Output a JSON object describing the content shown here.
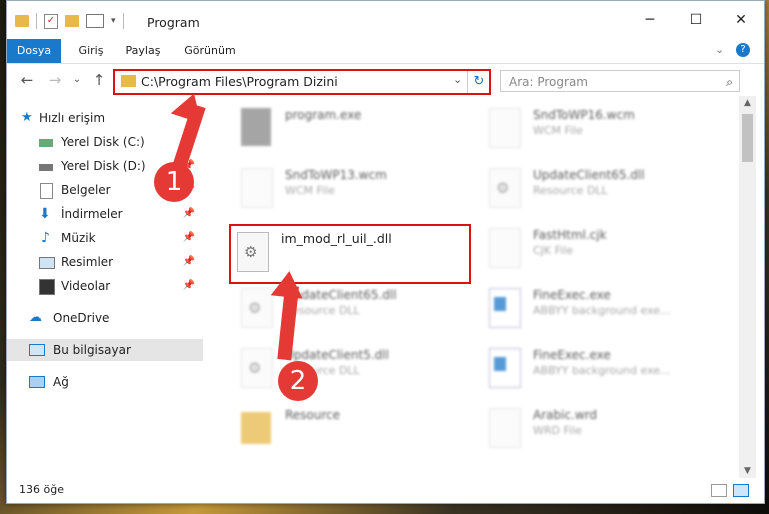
{
  "window": {
    "title": "Program",
    "minimize": "─",
    "maximize": "☐",
    "close": "✕"
  },
  "ribbon": {
    "tabs": [
      "Dosya",
      "Giriş",
      "Paylaş",
      "Görünüm"
    ],
    "collapse": "⌄",
    "help": "?"
  },
  "nav": {
    "back": "←",
    "forward": "→",
    "recent": "⌄",
    "up": "↑",
    "address": "C:\\Program Files\\Program Dizini",
    "dropdown": "⌄",
    "refresh": "↻",
    "search_placeholder": "Ara: Program",
    "search_icon": "⌕"
  },
  "sidebar": {
    "items": [
      {
        "label": "Hızlı erişim",
        "icon": "star-icon"
      },
      {
        "label": "Yerel Disk (C:)",
        "icon": "drive-icon",
        "pin": "📌"
      },
      {
        "label": "Yerel Disk (D:)",
        "icon": "drive-icon",
        "pin": "📌"
      },
      {
        "label": "Belgeler",
        "icon": "documents-icon",
        "pin": "📌"
      },
      {
        "label": "İndirmeler",
        "icon": "downloads-icon",
        "pin": "📌"
      },
      {
        "label": "Müzik",
        "icon": "music-icon",
        "pin": "📌"
      },
      {
        "label": "Resimler",
        "icon": "pictures-icon",
        "pin": "📌"
      },
      {
        "label": "Videolar",
        "icon": "videos-icon",
        "pin": "📌"
      },
      {
        "label": "OneDrive",
        "icon": "cloud-icon"
      },
      {
        "label": "Bu bilgisayar",
        "icon": "computer-icon"
      },
      {
        "label": "Ağ",
        "icon": "network-icon"
      }
    ]
  },
  "files": [
    {
      "name": "program.exe",
      "type": ""
    },
    {
      "name": "SndToWP16.wcm",
      "type": "WCM File"
    },
    {
      "name": "SndToWP13.wcm",
      "type": "WCM File"
    },
    {
      "name": "UpdateClient65.dll",
      "type": "Resource DLL"
    },
    {
      "name": "im_mod_rl_uil_.dll",
      "type": ""
    },
    {
      "name": "FastHtml.cjk",
      "type": "CJK File"
    },
    {
      "name": "UpdateClient65.dll",
      "type": "Resource DLL"
    },
    {
      "name": "FineExec.exe",
      "type": "ABBYY background exe..."
    },
    {
      "name": "UpdateClient5.dll",
      "type": "Resource DLL"
    },
    {
      "name": "FineExec.exe",
      "type": "ABBYY background exe..."
    },
    {
      "name": "Resource",
      "type": ""
    },
    {
      "name": "Arabic.wrd",
      "type": "WRD File"
    }
  ],
  "status": {
    "count": "136 öğe"
  },
  "annotations": {
    "badge1": "1",
    "badge2": "2"
  },
  "colors": {
    "accent": "#1979ca",
    "highlight": "#e53935"
  }
}
